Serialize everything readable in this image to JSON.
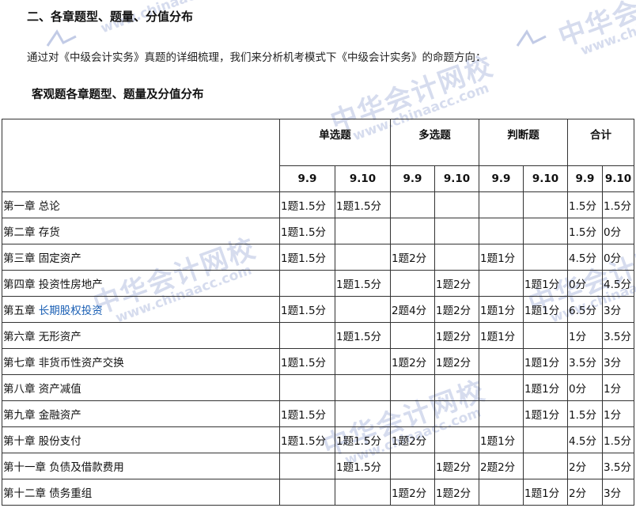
{
  "heading": "二、各章题型、题量、分值分布",
  "intro": "通过对《中级会计实务》真题的详细梳理，我们来分析机考模式下《中级会计实务》的命题方向：",
  "subheading": "客观题各章题型、题量及分值分布",
  "watermark": {
    "brand": "中华会计网校",
    "url": "www.chinaacc.com"
  },
  "table": {
    "groups": [
      "单选题",
      "多选题",
      "判断题",
      "合计"
    ],
    "subheaders": [
      "9.9",
      "9.10",
      "9.9",
      "9.10",
      "9.9",
      "9.10",
      "9.9",
      "9.10"
    ],
    "rows": [
      {
        "chapter": "第一章 总论",
        "cells": [
          "1题1.5分",
          "1题1.5分",
          "",
          "",
          "",
          "",
          "1.5分",
          "1.5分"
        ]
      },
      {
        "chapter": "第二章 存货",
        "cells": [
          "1题1.5分",
          "",
          "",
          "",
          "",
          "",
          "1.5分",
          "0分"
        ]
      },
      {
        "chapter": "第三章 固定资产",
        "cells": [
          "1题1.5分",
          "",
          "1题2分",
          "",
          "1题1分",
          "",
          "4.5分",
          "0分"
        ]
      },
      {
        "chapter": "第四章 投资性房地产",
        "cells": [
          "",
          "1题1.5分",
          "",
          "1题2分",
          "",
          "1题1分",
          "0分",
          "4.5分"
        ]
      },
      {
        "chapter_prefix": "第五章 ",
        "chapter_link": "长期股权投资",
        "cells": [
          "1题1.5分",
          "",
          "2题4分",
          "1题2分",
          "1题1分",
          "1题1分",
          "6.5分",
          "3分"
        ]
      },
      {
        "chapter": "第六章 无形资产",
        "cells": [
          "",
          "1题1.5分",
          "",
          "1题2分",
          "1题1分",
          "",
          "1分",
          "3.5分"
        ]
      },
      {
        "chapter": "第七章 非货币性资产交换",
        "cells": [
          "1题1.5分",
          "",
          "1题2分",
          "1题2分",
          "",
          "1题1分",
          "3.5分",
          "3分"
        ]
      },
      {
        "chapter": "第八章 资产减值",
        "cells": [
          "",
          "",
          "",
          "",
          "",
          "1题1分",
          "0分",
          "1分"
        ]
      },
      {
        "chapter": "第九章 金融资产",
        "cells": [
          "1题1.5分",
          "",
          "",
          "",
          "",
          "1题1分",
          "1.5分",
          "1分"
        ]
      },
      {
        "chapter": "第十章 股份支付",
        "cells": [
          "1题1.5分",
          "1题1.5分",
          "1题2分",
          "",
          "1题1分",
          "",
          "4.5分",
          "1.5分"
        ]
      },
      {
        "chapter": "第十一章 负债及借款费用",
        "cells": [
          "",
          "1题1.5分",
          "",
          "1题2分",
          "2题2分",
          "",
          "2分",
          "3.5分"
        ]
      },
      {
        "chapter": "第十二章 债务重组",
        "cells": [
          "",
          "",
          "1题2分",
          "1题2分",
          "",
          "1题1分",
          "2分",
          "3分"
        ]
      }
    ]
  }
}
